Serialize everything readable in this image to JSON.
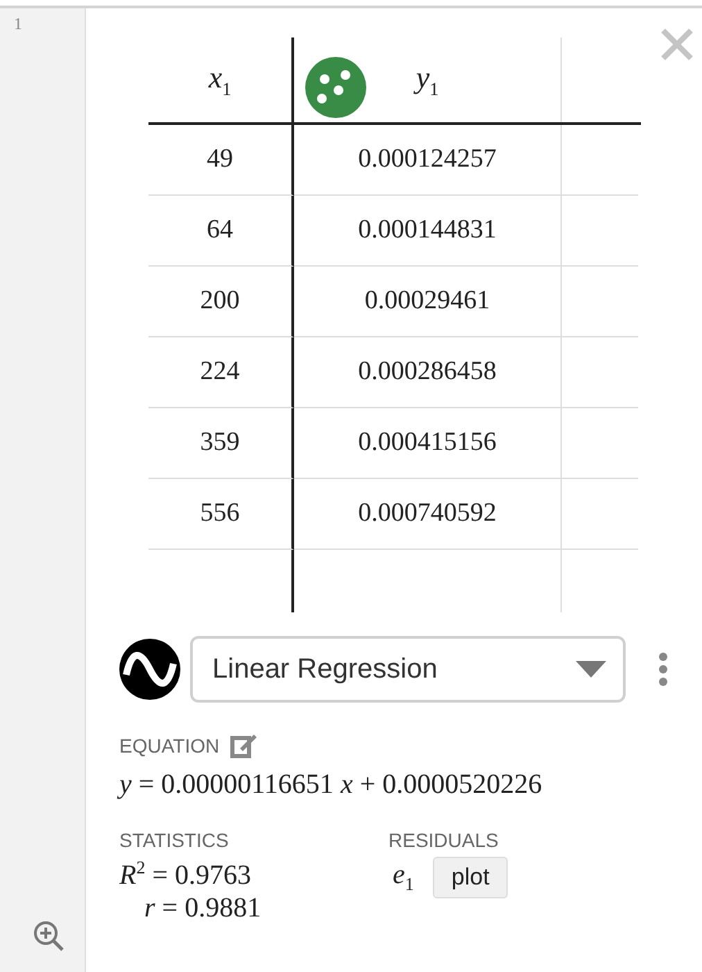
{
  "expression_number": "1",
  "table": {
    "columns": [
      {
        "label": "*x*$_{1}$"
      },
      {
        "label": "*y*$_{1}$",
        "color": "#388c46"
      }
    ],
    "rows": [
      [
        "49",
        "0.000124257"
      ],
      [
        "64",
        "0.000144831"
      ],
      [
        "200",
        "0.00029461"
      ],
      [
        "224",
        "0.000286458"
      ],
      [
        "359",
        "0.000415156"
      ],
      [
        "556",
        "0.000740592"
      ]
    ]
  },
  "regression": {
    "model": "Linear Regression",
    "equation_label": "EQUATION",
    "equation": "*y* = 0.00000116651 *x* + 0.0000520226",
    "statistics_label": "STATISTICS",
    "statistics": [
      "*R*$^{2}$ = 0.9763",
      "*r* = 0.9881"
    ],
    "residuals_label": "RESIDUALS",
    "residual_variable": "*e*$_{1}$",
    "plot_button": "plot"
  }
}
